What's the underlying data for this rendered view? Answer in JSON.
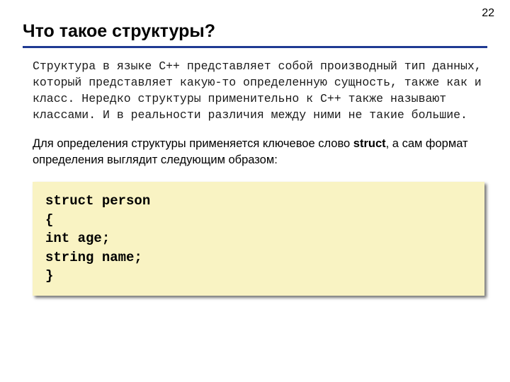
{
  "pageNumber": "22",
  "title": "Что такое структуры?",
  "paragraph1": "Структура в языке C++ представляет собой производный тип данных, который представляет какую-то определенную сущность, также как и класс. Нередко структуры применительно к C++ также называют классами. И в реальности различия между ними не такие большие.",
  "paragraph2_before": "Для определения структуры применяется ключевое слово ",
  "paragraph2_bold": "struct",
  "paragraph2_after": ", а сам формат определения выглядит следующим образом:",
  "code": "struct person\n{\nint age;\nstring name;\n}"
}
